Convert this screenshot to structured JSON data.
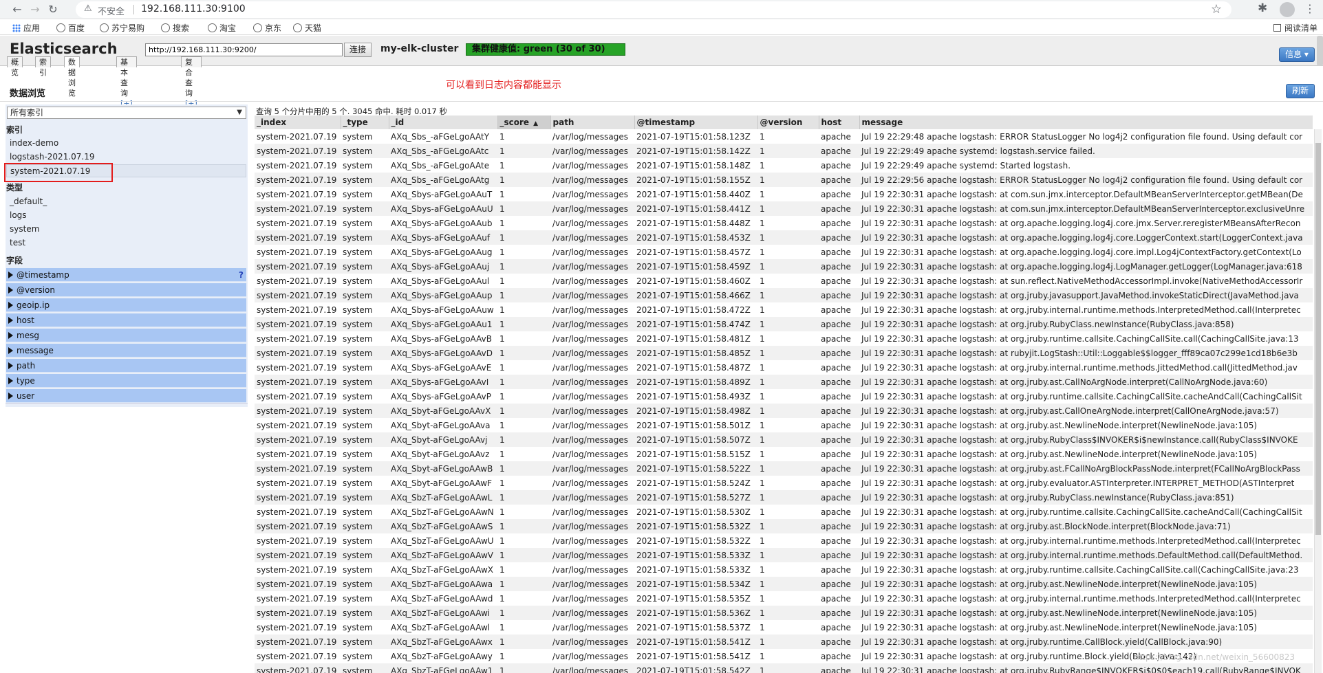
{
  "browser": {
    "insecure_label": "不安全",
    "url": "192.168.111.30:9100",
    "bookmarks": [
      "应用",
      "百度",
      "苏宁易购",
      "搜索",
      "淘宝",
      "京东",
      "天猫"
    ],
    "reading_list": "阅读清单"
  },
  "app": {
    "brand": "Elasticsearch",
    "connect_url": "http://192.168.111.30:9200/",
    "connect_label": "连接",
    "cluster_name": "my-elk-cluster",
    "health": "集群健康值: green (30 of 30)",
    "health_color": "#27a327",
    "info_label": "信息 ▾",
    "tabs": [
      {
        "label": "概览",
        "plus": ""
      },
      {
        "label": "索引",
        "plus": ""
      },
      {
        "label": "数据浏览",
        "plus": ""
      },
      {
        "label": "基本查询 ",
        "plus": "[+]"
      },
      {
        "label": "复合查询 ",
        "plus": "[+]"
      }
    ]
  },
  "page": {
    "title": "数据浏览",
    "annotation": "可以看到日志内容都能显示",
    "refresh_label": "刷新"
  },
  "sidebar": {
    "index_select": "所有索引",
    "index_heading": "索引",
    "indices": [
      "index-demo",
      "logstash-2021.07.19",
      "system-2021.07.19"
    ],
    "type_heading": "类型",
    "types": [
      "_default_",
      "logs",
      "system",
      "test"
    ],
    "field_heading": "字段",
    "fields": [
      "@timestamp",
      "@version",
      "geoip.ip",
      "host",
      "mesg",
      "message",
      "path",
      "type",
      "user"
    ],
    "help_mark": "?"
  },
  "results": {
    "summary": "查询 5 个分片中用的 5 个. 3045 命中. 耗时 0.017 秒",
    "columns": [
      "_index",
      "_type",
      "_id",
      "_score",
      "path",
      "@timestamp",
      "@version",
      "host",
      "message"
    ],
    "sort_arrow": "▲",
    "rows": [
      [
        "system-2021.07.19",
        "system",
        "AXq_Sbs_-aFGeLgoAAtY",
        "1",
        "/var/log/messages",
        "2021-07-19T15:01:58.123Z",
        "1",
        "apache",
        "Jul 19 22:29:48 apache logstash: ERROR StatusLogger No log4j2 configuration file found. Using default cor"
      ],
      [
        "system-2021.07.19",
        "system",
        "AXq_Sbs_-aFGeLgoAAtc",
        "1",
        "/var/log/messages",
        "2021-07-19T15:01:58.142Z",
        "1",
        "apache",
        "Jul 19 22:29:49 apache systemd: logstash.service failed."
      ],
      [
        "system-2021.07.19",
        "system",
        "AXq_Sbs_-aFGeLgoAAte",
        "1",
        "/var/log/messages",
        "2021-07-19T15:01:58.148Z",
        "1",
        "apache",
        "Jul 19 22:29:49 apache systemd: Started logstash."
      ],
      [
        "system-2021.07.19",
        "system",
        "AXq_Sbs_-aFGeLgoAAtg",
        "1",
        "/var/log/messages",
        "2021-07-19T15:01:58.155Z",
        "1",
        "apache",
        "Jul 19 22:29:56 apache logstash: ERROR StatusLogger No log4j2 configuration file found. Using default cor"
      ],
      [
        "system-2021.07.19",
        "system",
        "AXq_Sbys-aFGeLgoAAuT",
        "1",
        "/var/log/messages",
        "2021-07-19T15:01:58.440Z",
        "1",
        "apache",
        "Jul 19 22:30:31 apache logstash: at com.sun.jmx.interceptor.DefaultMBeanServerInterceptor.getMBean(De"
      ],
      [
        "system-2021.07.19",
        "system",
        "AXq_Sbys-aFGeLgoAAuU",
        "1",
        "/var/log/messages",
        "2021-07-19T15:01:58.441Z",
        "1",
        "apache",
        "Jul 19 22:30:31 apache logstash: at com.sun.jmx.interceptor.DefaultMBeanServerInterceptor.exclusiveUnre"
      ],
      [
        "system-2021.07.19",
        "system",
        "AXq_Sbys-aFGeLgoAAub",
        "1",
        "/var/log/messages",
        "2021-07-19T15:01:58.448Z",
        "1",
        "apache",
        "Jul 19 22:30:31 apache logstash: at org.apache.logging.log4j.core.jmx.Server.reregisterMBeansAfterRecon"
      ],
      [
        "system-2021.07.19",
        "system",
        "AXq_Sbys-aFGeLgoAAuf",
        "1",
        "/var/log/messages",
        "2021-07-19T15:01:58.453Z",
        "1",
        "apache",
        "Jul 19 22:30:31 apache logstash: at org.apache.logging.log4j.core.LoggerContext.start(LoggerContext.java"
      ],
      [
        "system-2021.07.19",
        "system",
        "AXq_Sbys-aFGeLgoAAug",
        "1",
        "/var/log/messages",
        "2021-07-19T15:01:58.457Z",
        "1",
        "apache",
        "Jul 19 22:30:31 apache logstash: at org.apache.logging.log4j.core.impl.Log4jContextFactory.getContext(Lo"
      ],
      [
        "system-2021.07.19",
        "system",
        "AXq_Sbys-aFGeLgoAAuj",
        "1",
        "/var/log/messages",
        "2021-07-19T15:01:58.459Z",
        "1",
        "apache",
        "Jul 19 22:30:31 apache logstash: at org.apache.logging.log4j.LogManager.getLogger(LogManager.java:618"
      ],
      [
        "system-2021.07.19",
        "system",
        "AXq_Sbys-aFGeLgoAAul",
        "1",
        "/var/log/messages",
        "2021-07-19T15:01:58.460Z",
        "1",
        "apache",
        "Jul 19 22:30:31 apache logstash: at sun.reflect.NativeMethodAccessorImpl.invoke(NativeMethodAccessorIr"
      ],
      [
        "system-2021.07.19",
        "system",
        "AXq_Sbys-aFGeLgoAAup",
        "1",
        "/var/log/messages",
        "2021-07-19T15:01:58.466Z",
        "1",
        "apache",
        "Jul 19 22:30:31 apache logstash: at org.jruby.javasupport.JavaMethod.invokeStaticDirect(JavaMethod.java"
      ],
      [
        "system-2021.07.19",
        "system",
        "AXq_Sbys-aFGeLgoAAuw",
        "1",
        "/var/log/messages",
        "2021-07-19T15:01:58.472Z",
        "1",
        "apache",
        "Jul 19 22:30:31 apache logstash: at org.jruby.internal.runtime.methods.InterpretedMethod.call(Interpretec"
      ],
      [
        "system-2021.07.19",
        "system",
        "AXq_Sbys-aFGeLgoAAu1",
        "1",
        "/var/log/messages",
        "2021-07-19T15:01:58.474Z",
        "1",
        "apache",
        "Jul 19 22:30:31 apache logstash: at org.jruby.RubyClass.newInstance(RubyClass.java:858)"
      ],
      [
        "system-2021.07.19",
        "system",
        "AXq_Sbys-aFGeLgoAAvB",
        "1",
        "/var/log/messages",
        "2021-07-19T15:01:58.481Z",
        "1",
        "apache",
        "Jul 19 22:30:31 apache logstash: at org.jruby.runtime.callsite.CachingCallSite.call(CachingCallSite.java:13"
      ],
      [
        "system-2021.07.19",
        "system",
        "AXq_Sbys-aFGeLgoAAvD",
        "1",
        "/var/log/messages",
        "2021-07-19T15:01:58.485Z",
        "1",
        "apache",
        "Jul 19 22:30:31 apache logstash: at rubyjit.LogStash::Util::Loggable$$logger_fff89ca07c299e1cd18b6e3b"
      ],
      [
        "system-2021.07.19",
        "system",
        "AXq_Sbys-aFGeLgoAAvE",
        "1",
        "/var/log/messages",
        "2021-07-19T15:01:58.487Z",
        "1",
        "apache",
        "Jul 19 22:30:31 apache logstash: at org.jruby.internal.runtime.methods.JittedMethod.call(JittedMethod.jav"
      ],
      [
        "system-2021.07.19",
        "system",
        "AXq_Sbys-aFGeLgoAAvI",
        "1",
        "/var/log/messages",
        "2021-07-19T15:01:58.489Z",
        "1",
        "apache",
        "Jul 19 22:30:31 apache logstash: at org.jruby.ast.CallNoArgNode.interpret(CallNoArgNode.java:60)"
      ],
      [
        "system-2021.07.19",
        "system",
        "AXq_Sbys-aFGeLgoAAvP",
        "1",
        "/var/log/messages",
        "2021-07-19T15:01:58.493Z",
        "1",
        "apache",
        "Jul 19 22:30:31 apache logstash: at org.jruby.runtime.callsite.CachingCallSite.cacheAndCall(CachingCallSit"
      ],
      [
        "system-2021.07.19",
        "system",
        "AXq_Sbyt-aFGeLgoAAvX",
        "1",
        "/var/log/messages",
        "2021-07-19T15:01:58.498Z",
        "1",
        "apache",
        "Jul 19 22:30:31 apache logstash: at org.jruby.ast.CallOneArgNode.interpret(CallOneArgNode.java:57)"
      ],
      [
        "system-2021.07.19",
        "system",
        "AXq_Sbyt-aFGeLgoAAva",
        "1",
        "/var/log/messages",
        "2021-07-19T15:01:58.501Z",
        "1",
        "apache",
        "Jul 19 22:30:31 apache logstash: at org.jruby.ast.NewlineNode.interpret(NewlineNode.java:105)"
      ],
      [
        "system-2021.07.19",
        "system",
        "AXq_Sbyt-aFGeLgoAAvj",
        "1",
        "/var/log/messages",
        "2021-07-19T15:01:58.507Z",
        "1",
        "apache",
        "Jul 19 22:30:31 apache logstash: at org.jruby.RubyClass$INVOKER$i$newInstance.call(RubyClass$INVOKE"
      ],
      [
        "system-2021.07.19",
        "system",
        "AXq_Sbyt-aFGeLgoAAvz",
        "1",
        "/var/log/messages",
        "2021-07-19T15:01:58.515Z",
        "1",
        "apache",
        "Jul 19 22:30:31 apache logstash: at org.jruby.ast.NewlineNode.interpret(NewlineNode.java:105)"
      ],
      [
        "system-2021.07.19",
        "system",
        "AXq_Sbyt-aFGeLgoAAwB",
        "1",
        "/var/log/messages",
        "2021-07-19T15:01:58.522Z",
        "1",
        "apache",
        "Jul 19 22:30:31 apache logstash: at org.jruby.ast.FCallNoArgBlockPassNode.interpret(FCallNoArgBlockPass"
      ],
      [
        "system-2021.07.19",
        "system",
        "AXq_Sbyt-aFGeLgoAAwF",
        "1",
        "/var/log/messages",
        "2021-07-19T15:01:58.524Z",
        "1",
        "apache",
        "Jul 19 22:30:31 apache logstash: at org.jruby.evaluator.ASTInterpreter.INTERPRET_METHOD(ASTInterpret"
      ],
      [
        "system-2021.07.19",
        "system",
        "AXq_SbzT-aFGeLgoAAwL",
        "1",
        "/var/log/messages",
        "2021-07-19T15:01:58.527Z",
        "1",
        "apache",
        "Jul 19 22:30:31 apache logstash: at org.jruby.RubyClass.newInstance(RubyClass.java:851)"
      ],
      [
        "system-2021.07.19",
        "system",
        "AXq_SbzT-aFGeLgoAAwN",
        "1",
        "/var/log/messages",
        "2021-07-19T15:01:58.530Z",
        "1",
        "apache",
        "Jul 19 22:30:31 apache logstash: at org.jruby.runtime.callsite.CachingCallSite.cacheAndCall(CachingCallSit"
      ],
      [
        "system-2021.07.19",
        "system",
        "AXq_SbzT-aFGeLgoAAwS",
        "1",
        "/var/log/messages",
        "2021-07-19T15:01:58.532Z",
        "1",
        "apache",
        "Jul 19 22:30:31 apache logstash: at org.jruby.ast.BlockNode.interpret(BlockNode.java:71)"
      ],
      [
        "system-2021.07.19",
        "system",
        "AXq_SbzT-aFGeLgoAAwU",
        "1",
        "/var/log/messages",
        "2021-07-19T15:01:58.532Z",
        "1",
        "apache",
        "Jul 19 22:30:31 apache logstash: at org.jruby.internal.runtime.methods.InterpretedMethod.call(Interpretec"
      ],
      [
        "system-2021.07.19",
        "system",
        "AXq_SbzT-aFGeLgoAAwV",
        "1",
        "/var/log/messages",
        "2021-07-19T15:01:58.533Z",
        "1",
        "apache",
        "Jul 19 22:30:31 apache logstash: at org.jruby.internal.runtime.methods.DefaultMethod.call(DefaultMethod."
      ],
      [
        "system-2021.07.19",
        "system",
        "AXq_SbzT-aFGeLgoAAwX",
        "1",
        "/var/log/messages",
        "2021-07-19T15:01:58.533Z",
        "1",
        "apache",
        "Jul 19 22:30:31 apache logstash: at org.jruby.runtime.callsite.CachingCallSite.call(CachingCallSite.java:23"
      ],
      [
        "system-2021.07.19",
        "system",
        "AXq_SbzT-aFGeLgoAAwa",
        "1",
        "/var/log/messages",
        "2021-07-19T15:01:58.534Z",
        "1",
        "apache",
        "Jul 19 22:30:31 apache logstash: at org.jruby.ast.NewlineNode.interpret(NewlineNode.java:105)"
      ],
      [
        "system-2021.07.19",
        "system",
        "AXq_SbzT-aFGeLgoAAwd",
        "1",
        "/var/log/messages",
        "2021-07-19T15:01:58.535Z",
        "1",
        "apache",
        "Jul 19 22:30:31 apache logstash: at org.jruby.internal.runtime.methods.InterpretedMethod.call(Interpretec"
      ],
      [
        "system-2021.07.19",
        "system",
        "AXq_SbzT-aFGeLgoAAwi",
        "1",
        "/var/log/messages",
        "2021-07-19T15:01:58.536Z",
        "1",
        "apache",
        "Jul 19 22:30:31 apache logstash: at org.jruby.ast.NewlineNode.interpret(NewlineNode.java:105)"
      ],
      [
        "system-2021.07.19",
        "system",
        "AXq_SbzT-aFGeLgoAAwl",
        "1",
        "/var/log/messages",
        "2021-07-19T15:01:58.537Z",
        "1",
        "apache",
        "Jul 19 22:30:31 apache logstash: at org.jruby.ast.NewlineNode.interpret(NewlineNode.java:105)"
      ],
      [
        "system-2021.07.19",
        "system",
        "AXq_SbzT-aFGeLgoAAwx",
        "1",
        "/var/log/messages",
        "2021-07-19T15:01:58.541Z",
        "1",
        "apache",
        "Jul 19 22:30:31 apache logstash: at org.jruby.runtime.CallBlock.yield(CallBlock.java:90)"
      ],
      [
        "system-2021.07.19",
        "system",
        "AXq_SbzT-aFGeLgoAAwy",
        "1",
        "/var/log/messages",
        "2021-07-19T15:01:58.541Z",
        "1",
        "apache",
        "Jul 19 22:30:31 apache logstash: at org.jruby.runtime.Block.yield(Block.java:142)"
      ],
      [
        "system-2021.07.19",
        "system",
        "AXq_SbzT-aFGeLgoAAw1",
        "1",
        "/var/log/messages",
        "2021-07-19T15:01:58.542Z",
        "1",
        "apache",
        "Jul 19 22:30:31 apache logstash: at org.jruby.RubyRange$INVOKER$i$0$0$each19.call(RubyRange$INVOK"
      ]
    ]
  },
  "watermark": "https://blog.csdn.net/weixin_56600823"
}
